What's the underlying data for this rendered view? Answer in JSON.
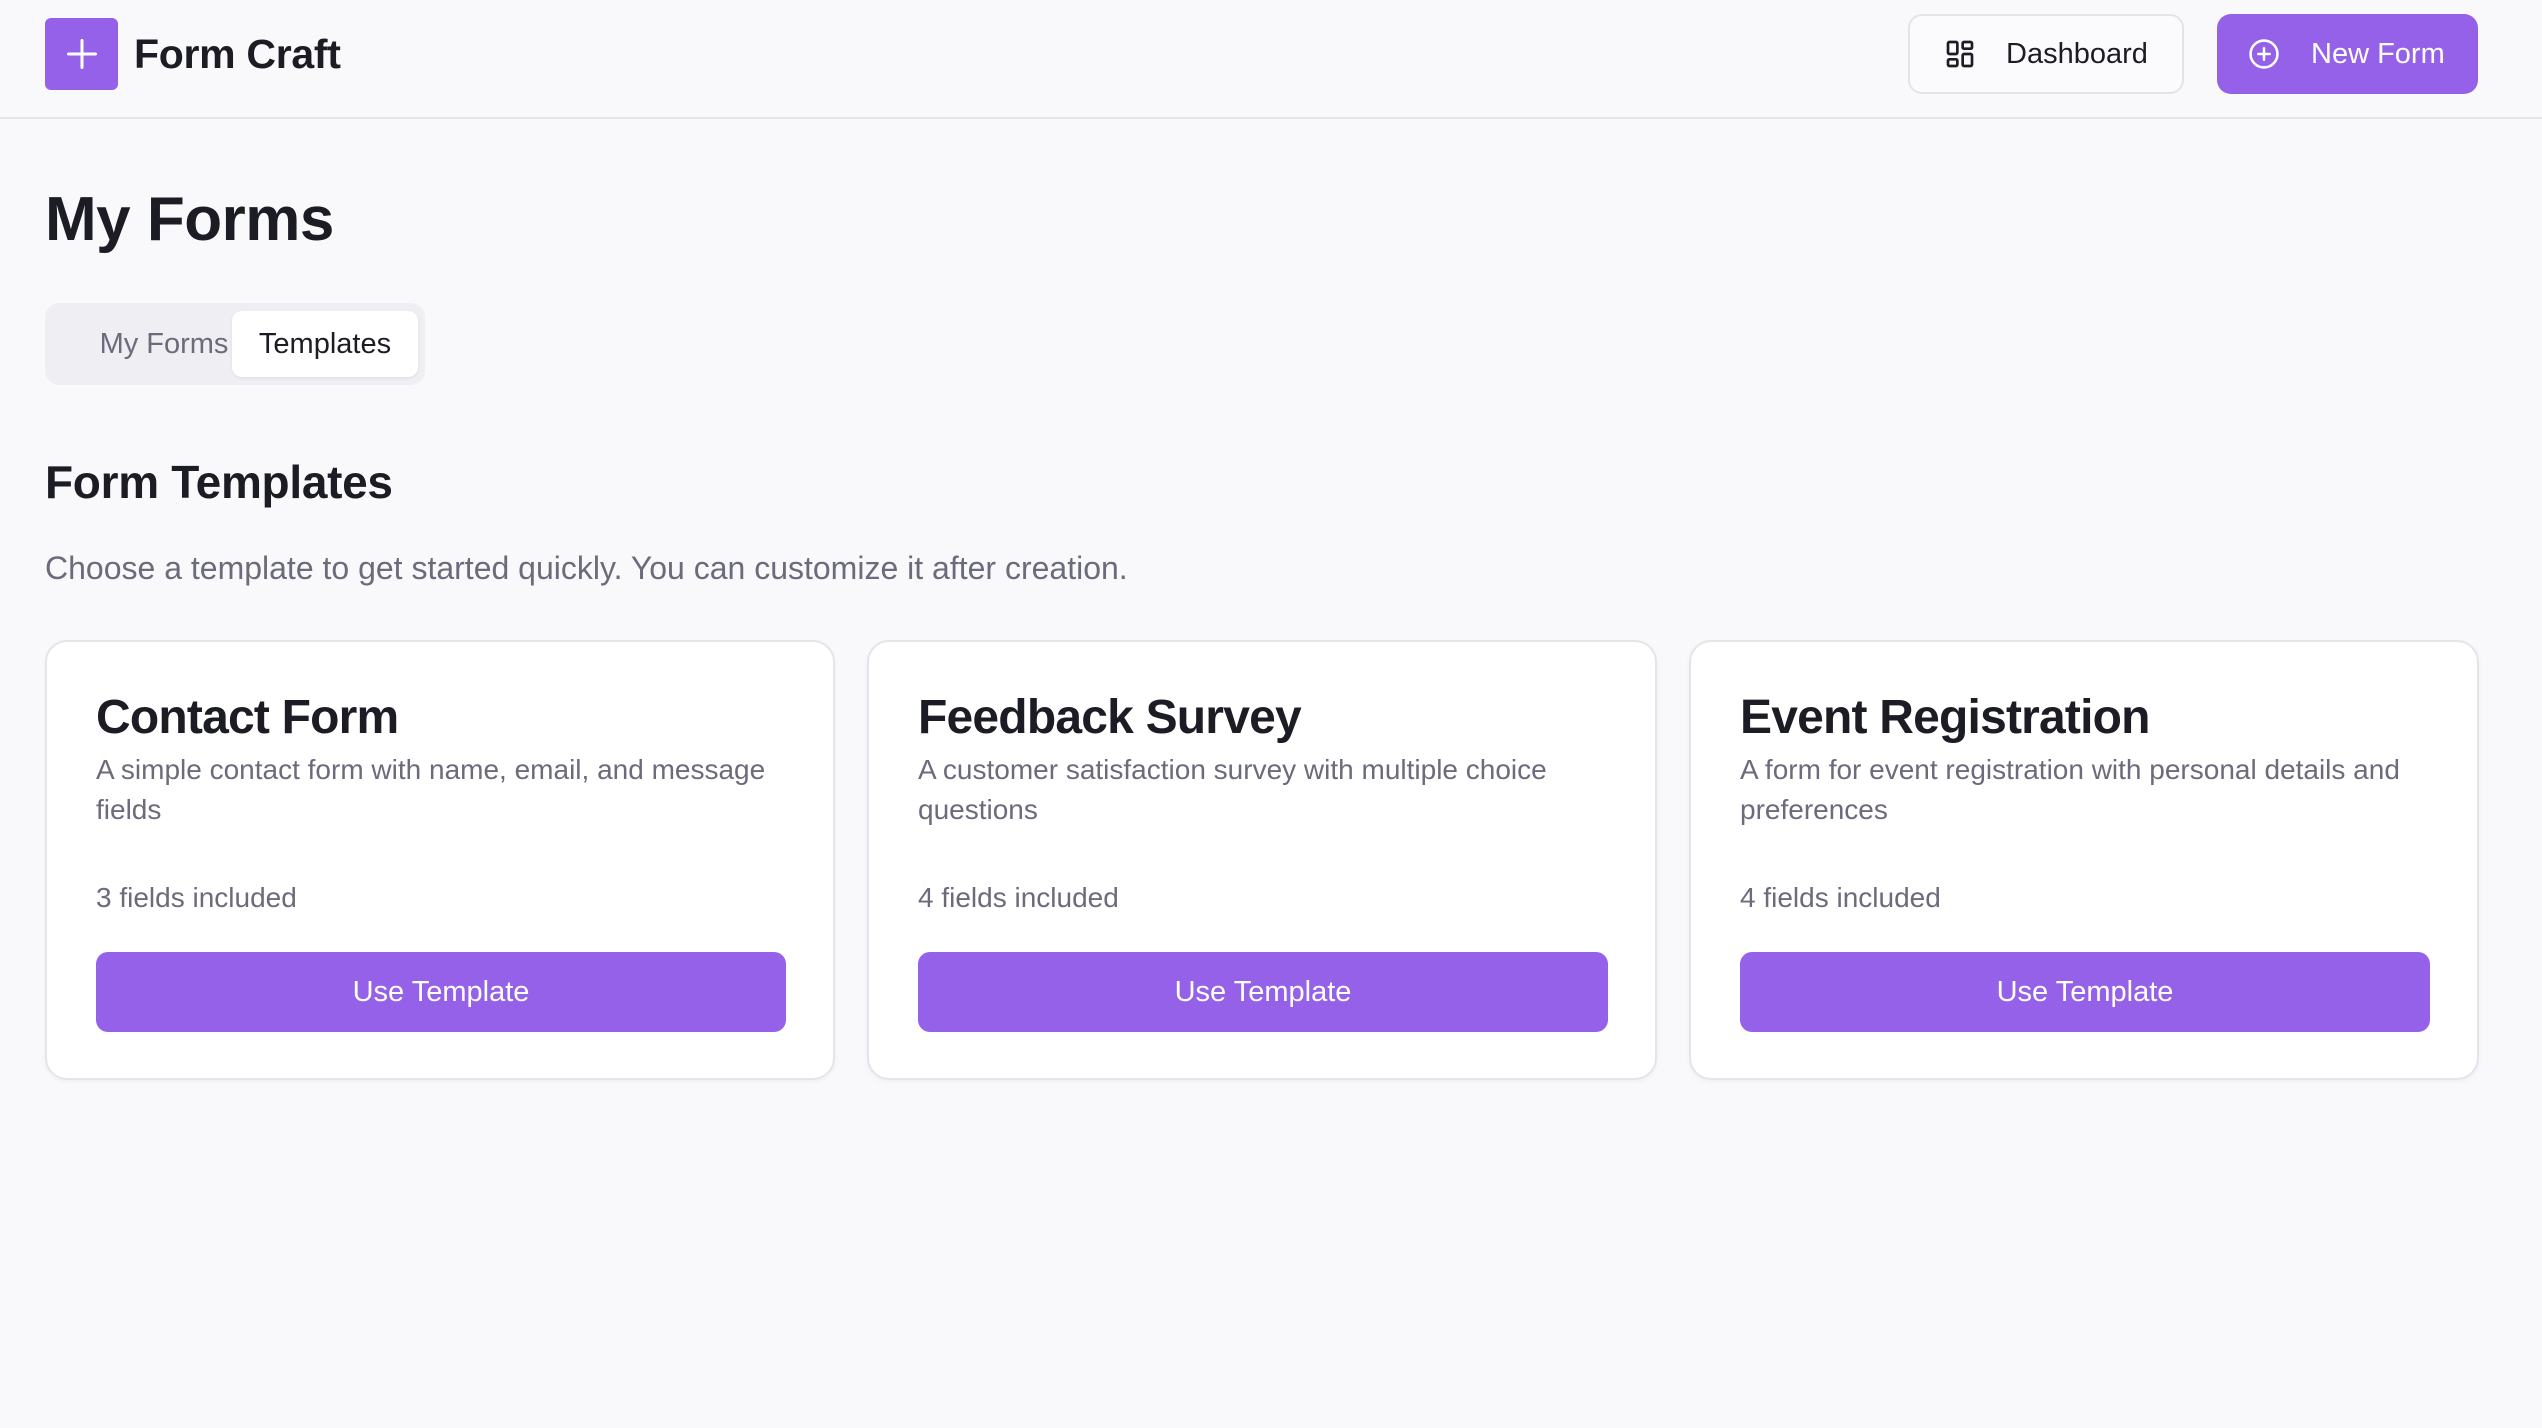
{
  "header": {
    "app_title": "Form Craft",
    "logo_icon": "plus-icon",
    "dashboard_label": "Dashboard",
    "dashboard_icon": "grid-icon",
    "new_form_label": "New Form",
    "new_form_icon": "plus-circle-icon"
  },
  "page": {
    "title": "My Forms"
  },
  "tabs": [
    {
      "label": "My Forms",
      "active": false
    },
    {
      "label": "Templates",
      "active": true
    }
  ],
  "section": {
    "title": "Form Templates",
    "description": "Choose a template to get started quickly. You can customize it after creation."
  },
  "templates": [
    {
      "title": "Contact Form",
      "description": "A simple contact form with name, email, and message fields",
      "fields": "3 fields included",
      "button_label": "Use Template"
    },
    {
      "title": "Feedback Survey",
      "description": "A customer satisfaction survey with multiple choice questions",
      "fields": "4 fields included",
      "button_label": "Use Template"
    },
    {
      "title": "Event Registration",
      "description": "A form for event registration with personal details and preferences",
      "fields": "4 fields included",
      "button_label": "Use Template"
    }
  ],
  "colors": {
    "accent": "#9461e8",
    "background": "#f9f9fb",
    "text_primary": "#1c1c24",
    "text_muted": "#6b6b7b",
    "border": "#e4e4ea"
  }
}
